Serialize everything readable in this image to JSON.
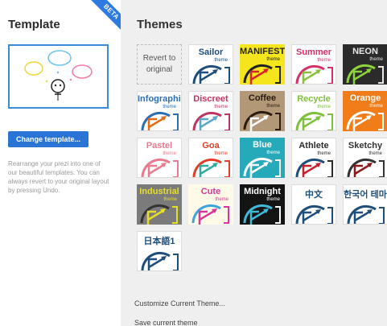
{
  "template_panel": {
    "title": "Template",
    "badge": "BETA",
    "change_button": "Change template...",
    "description": "Rearrange your prezi into one of our beautiful templates. You can always revert to your original layout by pressing Undo."
  },
  "themes_panel": {
    "title": "Themes",
    "revert_label": "Revert to original",
    "themes": [
      {
        "name": "Sailor",
        "sub": "theme",
        "bg": "#ffffff",
        "fg": "#1f4e7a",
        "arrow": "#1f4e7a",
        "arc": "#1f4e7a"
      },
      {
        "name": "MANIFESTO",
        "sub": "theme",
        "bg": "#f5e51c",
        "fg": "#222222",
        "arrow": "#d8232a",
        "arc": "#222222"
      },
      {
        "name": "Summer",
        "sub": "theme",
        "bg": "#ffffff",
        "fg": "#d2326b",
        "arrow": "#8cbf3f",
        "arc": "#d2326b"
      },
      {
        "name": "NEON",
        "sub": "theme",
        "bg": "#2b2b2b",
        "fg": "#e8e8e8",
        "arrow": "#8cd43a",
        "arc": "#8cd43a"
      },
      {
        "name": "Infographic",
        "sub": "theme",
        "bg": "#ffffff",
        "fg": "#2a6fb5",
        "arrow": "#e36c1b",
        "arc": "#2a6fb5"
      },
      {
        "name": "Discreet",
        "sub": "theme",
        "bg": "#ffffff",
        "fg": "#c0335f",
        "arrow": "#5aa6c7",
        "arc": "#c0335f"
      },
      {
        "name": "Coffee",
        "sub": "theme",
        "bg": "#b39877",
        "fg": "#2a1c10",
        "arrow": "#ffffff",
        "arc": "#2a1c10"
      },
      {
        "name": "Recycle",
        "sub": "theme",
        "bg": "#ffffff",
        "fg": "#7fbf3d",
        "arrow": "#7fbf3d",
        "arc": "#7fbf3d"
      },
      {
        "name": "Orange",
        "sub": "theme",
        "bg": "#f07d1a",
        "fg": "#ffffff",
        "arrow": "#ffffff",
        "arc": "#ffffff"
      },
      {
        "name": "Pastel",
        "sub": "theme",
        "bg": "#ffffff",
        "fg": "#e87b8f",
        "arrow": "#e87b8f",
        "arc": "#e87b8f"
      },
      {
        "name": "Goa",
        "sub": "theme",
        "bg": "#ffffff",
        "fg": "#e23f28",
        "arrow": "#2eab9c",
        "arc": "#e23f28"
      },
      {
        "name": "Blue",
        "sub": "theme",
        "bg": "#26a9b8",
        "fg": "#ffffff",
        "arrow": "#ffffff",
        "arc": "#ffffff"
      },
      {
        "name": "Athlete",
        "sub": "theme",
        "bg": "#ffffff",
        "fg": "#2b2b2b",
        "arrow": "#c81e2b",
        "arc": "#1f4e7a"
      },
      {
        "name": "Sketchy",
        "sub": "theme",
        "bg": "#ffffff",
        "fg": "#333333",
        "arrow": "#8a1a1a",
        "arc": "#333333"
      },
      {
        "name": "Industrial",
        "sub": "theme",
        "bg": "#7b7b7b",
        "fg": "#e6df2a",
        "arrow": "#e6df2a",
        "arc": "#333333"
      },
      {
        "name": "Cute",
        "sub": "theme",
        "bg": "#fff9e8",
        "fg": "#d8369b",
        "arrow": "#d8369b",
        "arc": "#3da5d9"
      },
      {
        "name": "Midnight",
        "sub": "theme",
        "bg": "#141414",
        "fg": "#ffffff",
        "arrow": "#3fbad8",
        "arc": "#3fbad8"
      },
      {
        "name": "中文",
        "sub": "",
        "bg": "#ffffff",
        "fg": "#1f4e7a",
        "arrow": "#1f4e7a",
        "arc": "#1f4e7a"
      },
      {
        "name": "한국어 테마",
        "sub": "",
        "bg": "#ffffff",
        "fg": "#1f4e7a",
        "arrow": "#1f4e7a",
        "arc": "#1f4e7a"
      },
      {
        "name": "日本語1",
        "sub": "",
        "bg": "#ffffff",
        "fg": "#1f4e7a",
        "arrow": "#1f4e7a",
        "arc": "#1f4e7a"
      }
    ],
    "customize_link": "Customize Current Theme...",
    "save_link": "Save current theme"
  }
}
